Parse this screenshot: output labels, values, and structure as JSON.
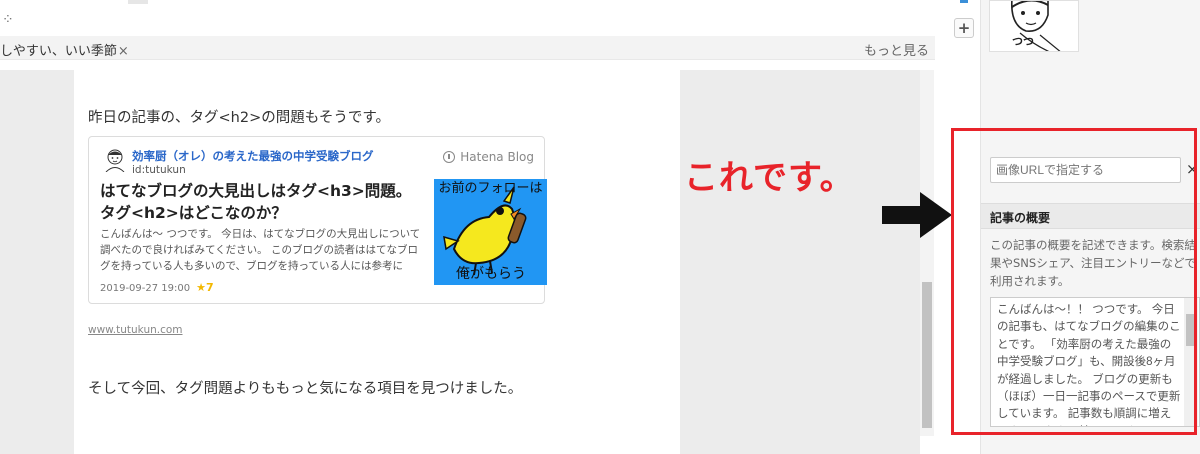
{
  "top": {
    "sparkle": "⁘"
  },
  "tagbar": {
    "tag": "しやすい、いい季節",
    "remove": "×",
    "more": "もっと見る"
  },
  "article": {
    "paragraph1": "昨日の記事の、タグ<h2>の問題もそうです。",
    "card": {
      "blog_name": "効率厨（オレ）の考えた最強の中学受験ブログ",
      "user_id": "id:tutukun",
      "brand": "Hatena Blog",
      "title": "はてなブログの大見出しはタグ<h3>問題。タグ<h2>はどこなのか？",
      "excerpt": "こんばんは～ つつです。 今日は、はてなブログの大見出しについて調べたので良ければみてください。 このブログの読者ははてなブログを持っている人も多いので、ブログを持っている人には参考に",
      "date": "2019-09-27 19:00",
      "stars": "★7",
      "thumb_top": "お前のフォローは",
      "thumb_bottom": "俺がもらう"
    },
    "url": "www.tutukun.com",
    "paragraph2": "そして今回、タグ問題よりももっと気になる項目を見つけました。"
  },
  "toolbar": {
    "plus": "+"
  },
  "sidebar": {
    "avatar_label": "つつ",
    "image_url_placeholder": "画像URLで指定する",
    "close": "×",
    "summary_title": "記事の概要",
    "summary_desc": "この記事の概要を記述できます。検索結果やSNSシェア、注目エントリーなどで利用されます。",
    "summary_text": "こんばんは～！！ つつです。 今日の記事も、はてなブログの編集のことです。 「効率厨の考えた最強の中学受験ブログ」も、開設後8ヶ月が経過しました。 ブログの更新も（ほぼ）一日一記事のペースで更新しています。 記事数も順調に増えてきています。 嬉しいです。"
  },
  "annotation": {
    "text": "これです。"
  },
  "colors": {
    "accent_red": "#e8232a",
    "link_blue": "#2a67c9",
    "thumb_blue": "#2196f3",
    "star": "#f3b800"
  }
}
